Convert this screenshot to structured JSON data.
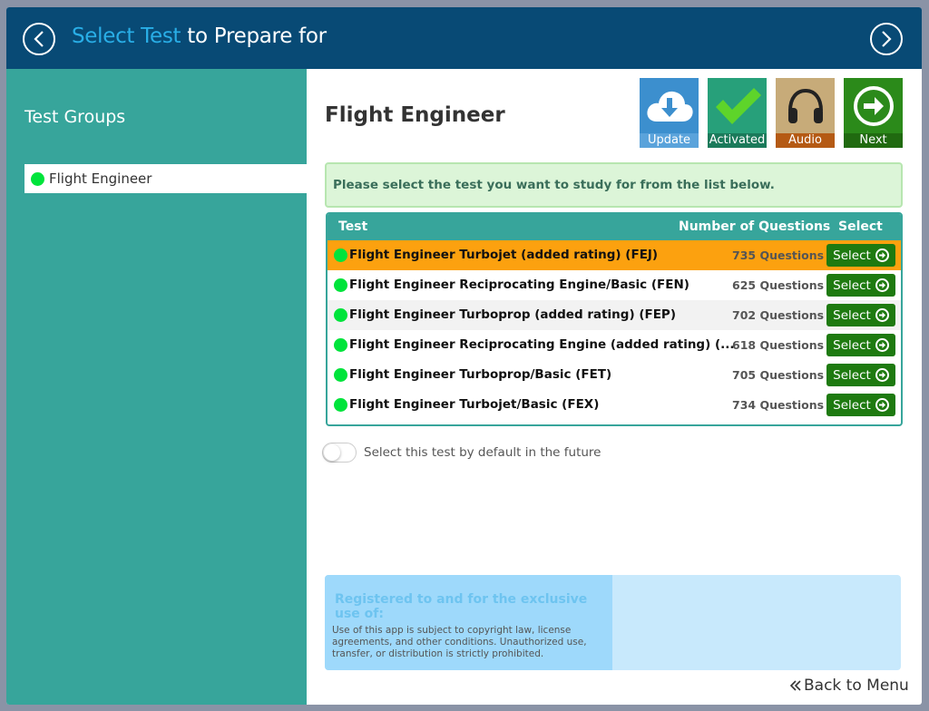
{
  "header": {
    "title_accent": "Select Test",
    "title_rest": " to Prepare for"
  },
  "sidebar": {
    "heading": "Test Groups",
    "groups": [
      {
        "label": "Flight Engineer",
        "status_color": "#00e43b"
      }
    ]
  },
  "main": {
    "title": "Flight Engineer",
    "toolbar": {
      "update_label": "Update",
      "activated_label": "Activated",
      "audio_label": "Audio",
      "next_label": "Next"
    },
    "instruction": "Please select the test you want to study for from the list below.",
    "table": {
      "headers": {
        "test": "Test",
        "count": "Number of Questions",
        "select": "Select"
      },
      "rows": [
        {
          "name": "Flight Engineer Turbojet (added rating) (FEJ)",
          "count": "735 Questions",
          "select": "Select"
        },
        {
          "name": "Flight Engineer Reciprocating Engine/Basic (FEN)",
          "count": "625 Questions",
          "select": "Select"
        },
        {
          "name": "Flight Engineer Turboprop (added rating) (FEP)",
          "count": "702 Questions",
          "select": "Select"
        },
        {
          "name": "Flight Engineer Reciprocating Engine (added rating) (...",
          "count": "618 Questions",
          "select": "Select"
        },
        {
          "name": "Flight Engineer Turboprop/Basic (FET)",
          "count": "705 Questions",
          "select": "Select"
        },
        {
          "name": "Flight Engineer Turbojet/Basic (FEX)",
          "count": "734 Questions",
          "select": "Select"
        }
      ]
    },
    "default_toggle": {
      "label": "Select this test by default in the future",
      "on": false
    },
    "registration": {
      "title": "Registered to and for the exclusive use of:",
      "notice": "Use of this app is subject to copyright law, license agreements, and other conditions. Unauthorized use, transfer, or distribution is strictly prohibited."
    },
    "back_to_menu": "Back to Menu"
  },
  "colors": {
    "header_bg": "#084a75",
    "accent_blue": "#29aee7",
    "sidebar_bg": "#37a59b",
    "highlight_row": "#fca10f",
    "select_button": "#1e7a10",
    "status_dot": "#00e43b"
  }
}
